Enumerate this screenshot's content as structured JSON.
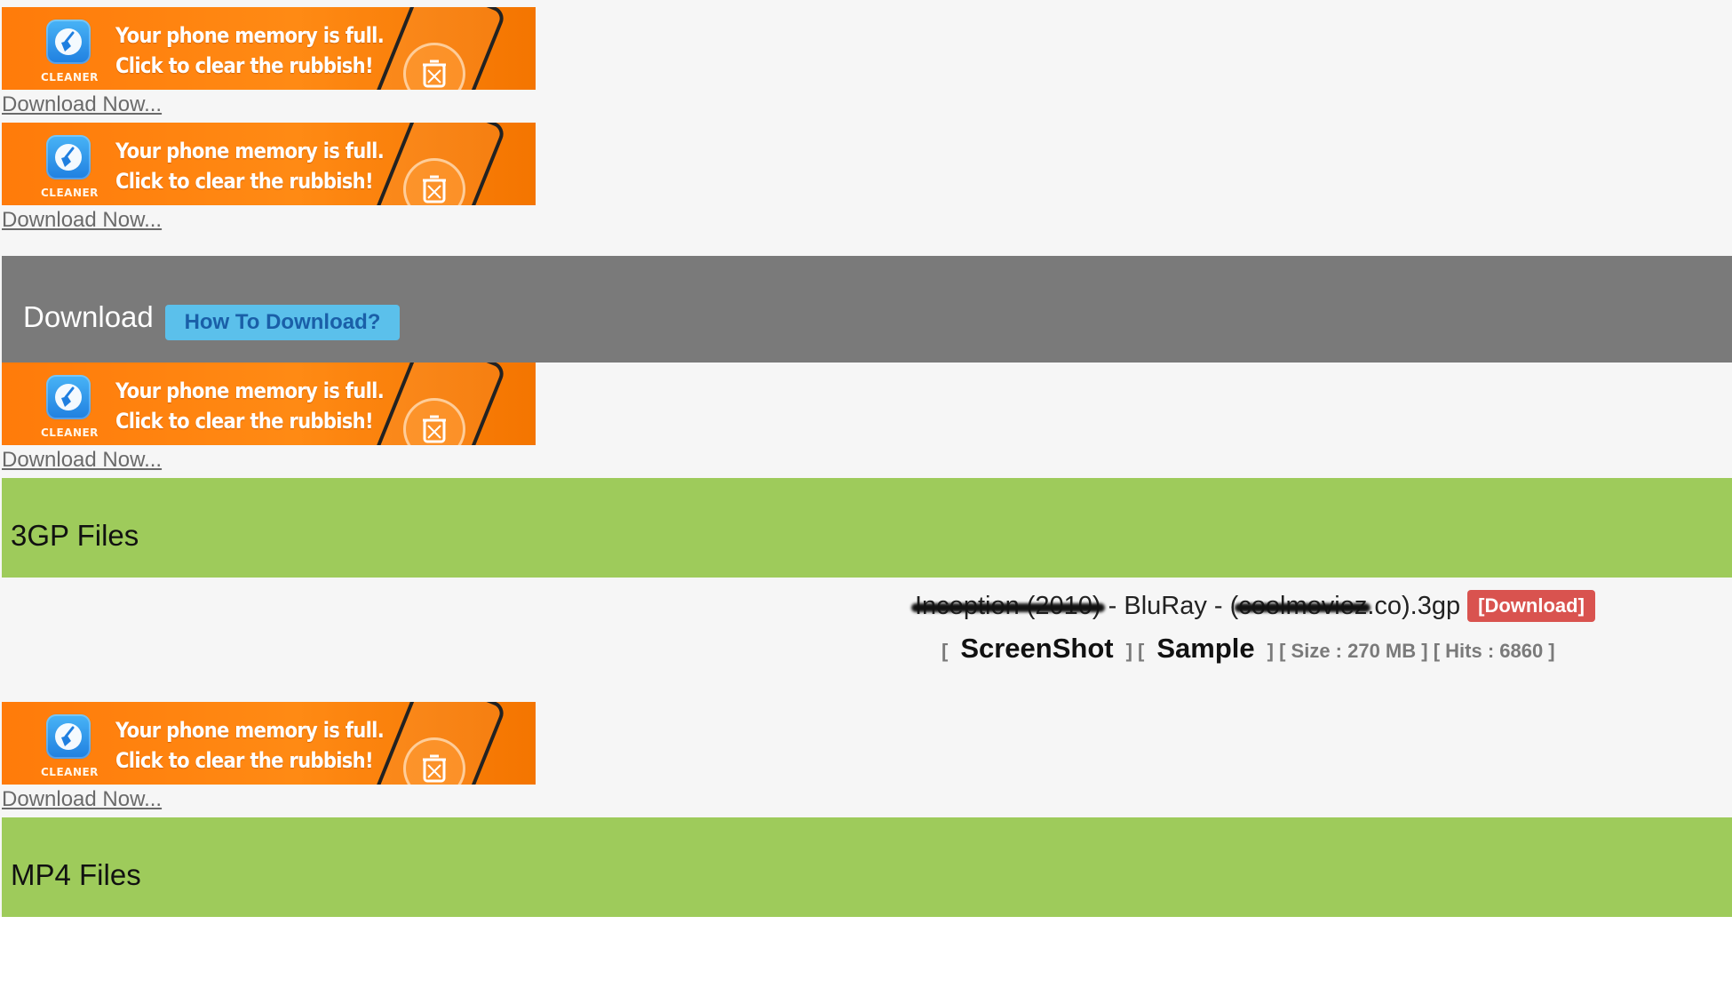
{
  "ads": [
    {
      "line1": "Your phone memory is full.",
      "line2": "Click to clear the rubbish!",
      "brand": "CLEANER",
      "link": "Download Now..."
    },
    {
      "line1": "Your phone memory is full.",
      "line2": "Click to clear the rubbish!",
      "brand": "CLEANER",
      "link": "Download Now..."
    },
    {
      "line1": "Your phone memory is full.",
      "line2": "Click to clear the rubbish!",
      "brand": "CLEANER",
      "link": "Download Now..."
    },
    {
      "line1": "Your phone memory is full.",
      "line2": "Click to clear the rubbish!",
      "brand": "CLEANER",
      "link": "Download Now..."
    }
  ],
  "download_header": {
    "title": "Download",
    "how_to_button": "How To Download?"
  },
  "sections": {
    "threegp": "3GP Files",
    "mp4": "MP4 Files"
  },
  "file": {
    "name_part1": "Inception (2010)",
    "name_part2": " - BluRay - (",
    "name_part3": "coolmoviez",
    "name_part4": ".co).3gp",
    "download_badge": "[Download]",
    "bracket_open": "[",
    "screenshot": "ScreenShot",
    "bracket_mid": "] [",
    "sample": "Sample",
    "size": "] [ Size : 270 MB ]",
    "hits": "[ Hits : 6860 ]"
  },
  "colors": {
    "ad_orange": "#ff7b0a",
    "gray_bar": "#7a7a7a",
    "how_button": "#5bc0eb",
    "green_bar": "#9ecb5b",
    "download_badge": "#d9534f"
  },
  "icons": {
    "app": "broom-cleaner-icon",
    "trash": "trash-bin-icon"
  }
}
